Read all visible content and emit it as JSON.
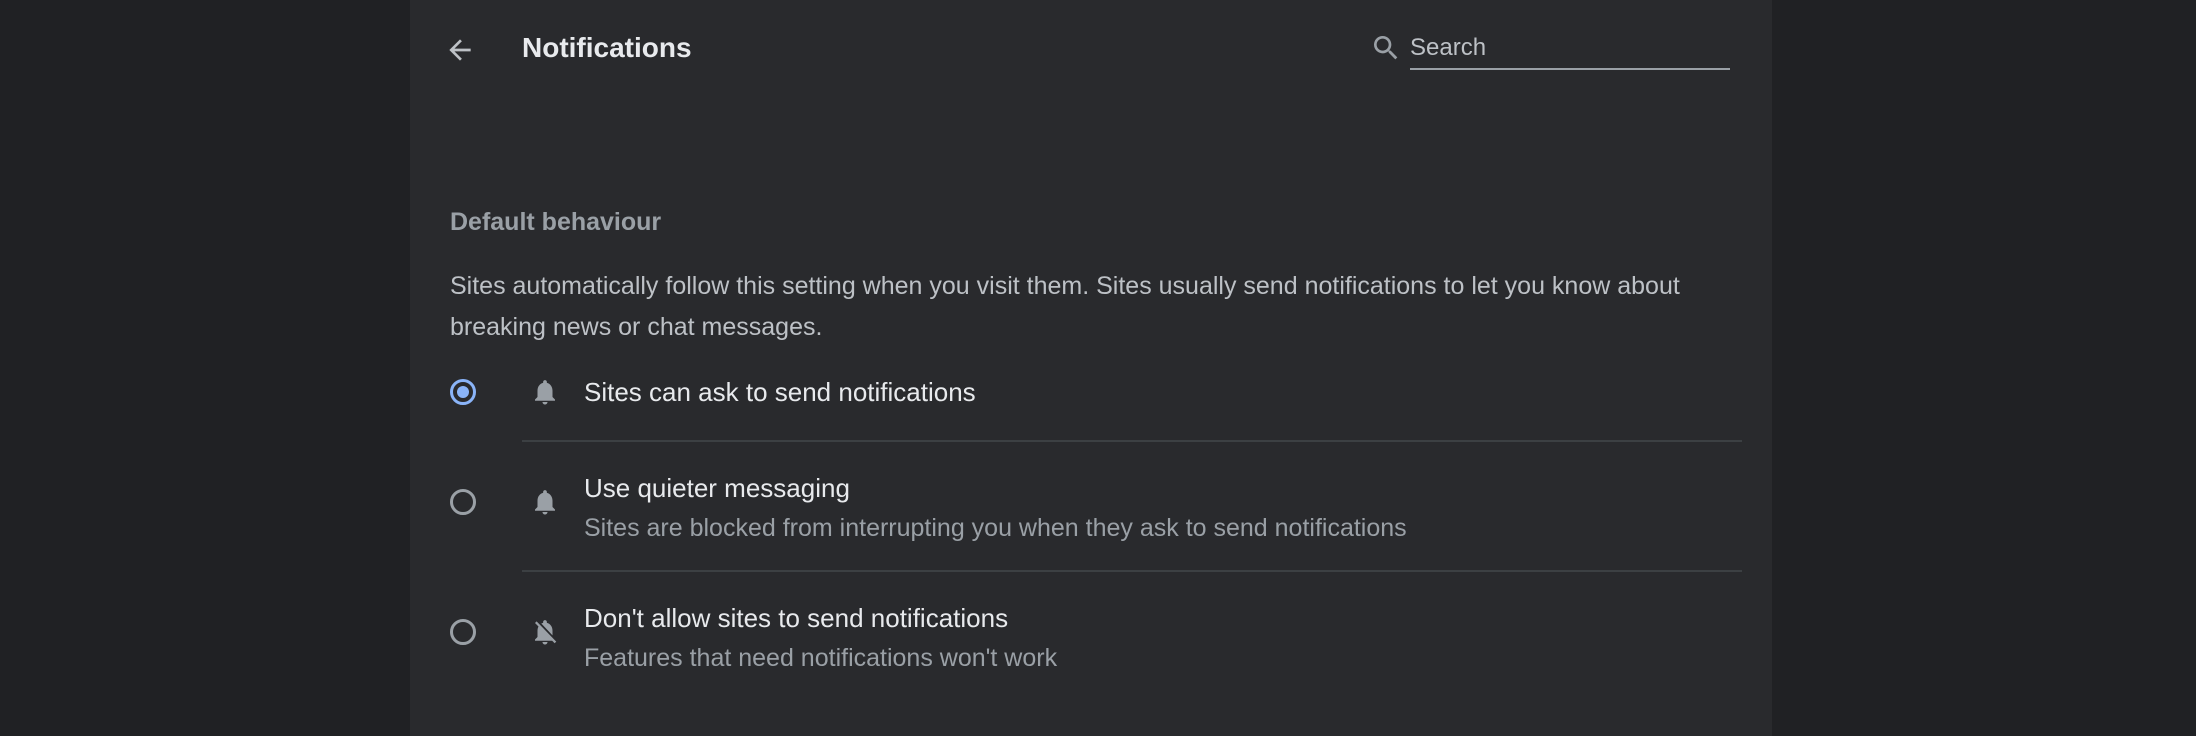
{
  "header": {
    "title": "Notifications",
    "search_placeholder": "Search",
    "search_value": ""
  },
  "section": {
    "heading": "Default behaviour",
    "description": "Sites automatically follow this setting when you visit them. Sites usually send notifications to let you know about breaking news or chat messages."
  },
  "options": [
    {
      "label": "Sites can ask to send notifications",
      "sublabel": "",
      "icon": "bell-icon",
      "selected": true
    },
    {
      "label": "Use quieter messaging",
      "sublabel": "Sites are blocked from interrupting you when they ask to send notifications",
      "icon": "bell-icon",
      "selected": false
    },
    {
      "label": "Don't allow sites to send notifications",
      "sublabel": "Features that need notifications won't work",
      "icon": "bell-off-icon",
      "selected": false
    }
  ],
  "colors": {
    "page_bg": "#202124",
    "card_bg": "#292a2d",
    "accent": "#8ab4f8",
    "primary_text": "#e8eaed",
    "secondary_text": "#9aa0a6"
  }
}
